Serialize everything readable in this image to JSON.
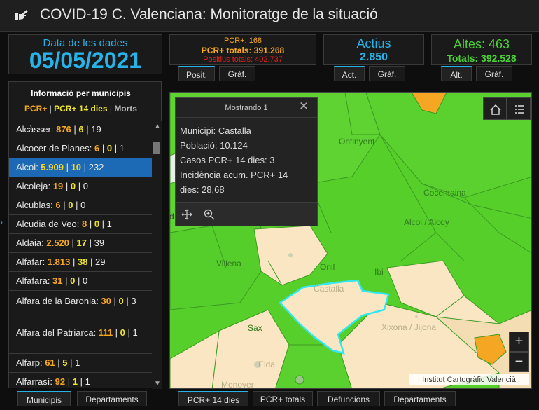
{
  "header": {
    "title": "COVID-19 C. Valenciana: Monitoratge de la situació",
    "logo_icon": "hand-pointing-icon"
  },
  "stats": {
    "date": {
      "label": "Data de les dades",
      "value": "05/05/2021"
    },
    "pcr": {
      "line1": "PCR+: 168",
      "line2": "PCR+ totals: 391.268",
      "line3": "Positius totals: 402.737"
    },
    "active": {
      "label": "Actius",
      "value": "2.850"
    },
    "discharges": {
      "label": "Altes: 463",
      "total": "Totals: 392.528"
    }
  },
  "top_tabs": {
    "pcr": [
      "Posit.",
      "Gràf."
    ],
    "active": [
      "Act.",
      "Gràf."
    ],
    "discharges": [
      "Alt.",
      "Gràf."
    ]
  },
  "sidebar": {
    "title": "Informació per municipis",
    "legend": {
      "a": "PCR+",
      "sep1": " | ",
      "b": "PCR+ 14 dies",
      "sep2": " | ",
      "c": "Morts"
    },
    "rows": [
      {
        "name": "Alcàsser",
        "v1": "876",
        "v2": "6",
        "v3": "19"
      },
      {
        "name": "Alcocer de Planes",
        "v1": "6",
        "v2": "0",
        "v3": "1"
      },
      {
        "name": "Alcoi",
        "v1": "5.909",
        "v2": "10",
        "v3": "232"
      },
      {
        "name": "Alcoleja",
        "v1": "19",
        "v2": "0",
        "v3": "0"
      },
      {
        "name": "Alcublas",
        "v1": "6",
        "v2": "0",
        "v3": "0"
      },
      {
        "name": "Alcudia de Veo",
        "v1": "8",
        "v2": "0",
        "v3": "1"
      },
      {
        "name": "Aldaia",
        "v1": "2.520",
        "v2": "17",
        "v3": "39"
      },
      {
        "name": "Alfafar",
        "v1": "1.813",
        "v2": "38",
        "v3": "29"
      },
      {
        "name": "Alfafara",
        "v1": "31",
        "v2": "0",
        "v3": "0"
      },
      {
        "name": "Alfara de la Baronia",
        "v1": "30",
        "v2": "0",
        "v3": "3"
      },
      {
        "name": "Alfara del Patriarca",
        "v1": "111",
        "v2": "0",
        "v3": "1"
      },
      {
        "name": "Alfarp",
        "v1": "61",
        "v2": "5",
        "v3": "1"
      },
      {
        "name": "Alfarrasí",
        "v1": "92",
        "v2": "1",
        "v3": "1"
      }
    ],
    "selected_index": 2
  },
  "bottom_tabs": {
    "left": [
      "Municipis",
      "Departaments"
    ],
    "right": [
      "PCR+ 14 dies",
      "PCR+ totals",
      "Defuncions",
      "Departaments"
    ]
  },
  "map": {
    "labels": [
      "Ontinyent",
      "Cocentaina",
      "Alcoi / Alcoy",
      "Villena",
      "Onil",
      "Ibi",
      "Castalla",
      "Sax",
      "Xixona / Jijona",
      "Elda",
      "Monover",
      "d"
    ],
    "attribution": "Institut Cartogràfic Valencià",
    "zoom_in": "+",
    "zoom_out": "−",
    "colors": {
      "green": "#56cf2b",
      "light_green": "#8fe06a",
      "beige": "#fae6c3",
      "orange": "#f5a623",
      "highlight": "#33e6f0"
    }
  },
  "popup": {
    "title": "Mostrando 1",
    "lines": [
      "Municipi: Castalla",
      "Població: 10.124",
      "Casos PCR+ 14 dies: 3",
      "Incidència acum. PCR+ 14",
      "dies: 28,68"
    ],
    "icons": [
      "move-icon",
      "zoom-to-icon"
    ]
  }
}
